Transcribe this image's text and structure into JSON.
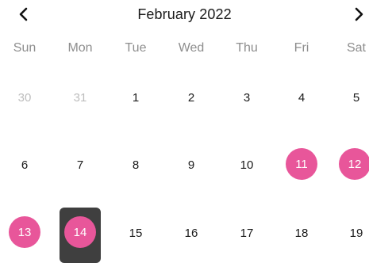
{
  "header": {
    "title": "February 2022",
    "prev_icon": "chevron-left-icon",
    "next_icon": "chevron-right-icon"
  },
  "weekdays": [
    "Sun",
    "Mon",
    "Tue",
    "Wed",
    "Thu",
    "Fri",
    "Sat"
  ],
  "weeks": [
    [
      {
        "label": "30",
        "state": "muted"
      },
      {
        "label": "31",
        "state": "muted"
      },
      {
        "label": "1",
        "state": "normal"
      },
      {
        "label": "2",
        "state": "normal"
      },
      {
        "label": "3",
        "state": "normal"
      },
      {
        "label": "4",
        "state": "normal"
      },
      {
        "label": "5",
        "state": "normal"
      }
    ],
    [
      {
        "label": "6",
        "state": "normal"
      },
      {
        "label": "7",
        "state": "normal"
      },
      {
        "label": "8",
        "state": "normal"
      },
      {
        "label": "9",
        "state": "normal"
      },
      {
        "label": "10",
        "state": "normal"
      },
      {
        "label": "11",
        "state": "highlight"
      },
      {
        "label": "12",
        "state": "highlight"
      }
    ],
    [
      {
        "label": "13",
        "state": "highlight"
      },
      {
        "label": "14",
        "state": "selected"
      },
      {
        "label": "15",
        "state": "normal"
      },
      {
        "label": "16",
        "state": "normal"
      },
      {
        "label": "17",
        "state": "normal"
      },
      {
        "label": "18",
        "state": "normal"
      },
      {
        "label": "19",
        "state": "normal"
      }
    ]
  ],
  "colors": {
    "highlight": "#e8569a",
    "selected_box": "#3f3f3f",
    "muted_text": "#bdbdbd",
    "weekday_text": "#8e8e8e"
  }
}
